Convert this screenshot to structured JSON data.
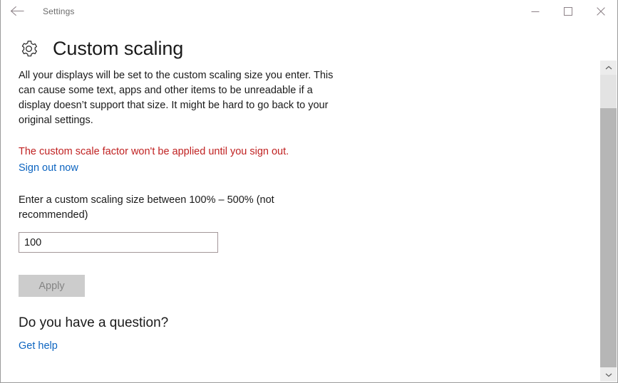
{
  "window": {
    "titlebar": {
      "back_icon": "back-arrow-icon",
      "title": "Settings",
      "minimize_icon": "minimize-icon",
      "maximize_icon": "maximize-icon",
      "close_icon": "close-icon"
    }
  },
  "page": {
    "icon": "gear-icon",
    "title": "Custom scaling",
    "description": "All your displays will be set to the custom scaling size you enter. This can cause some text, apps and other items to be unreadable if a display doesn’t support that size. It might be hard to go back to your original settings.",
    "warning": "The custom scale factor won't be applied until you sign out.",
    "signout_link": "Sign out now",
    "field_label": "Enter a custom scaling size between 100% – 500% (not recommended)",
    "scale_value": "100",
    "scale_placeholder": "",
    "apply_label": "Apply",
    "question_heading": "Do you have a question?",
    "get_help_link": "Get help"
  },
  "scrollbar": {
    "up_arrow_icon": "chevron-up-icon",
    "down_arrow_icon": "chevron-down-icon"
  },
  "colors": {
    "warning_red": "#c02222",
    "link_blue": "#0c64c0",
    "input_border": "#a39799",
    "disabled_button_bg": "#cccccc",
    "disabled_button_text": "#848484"
  }
}
